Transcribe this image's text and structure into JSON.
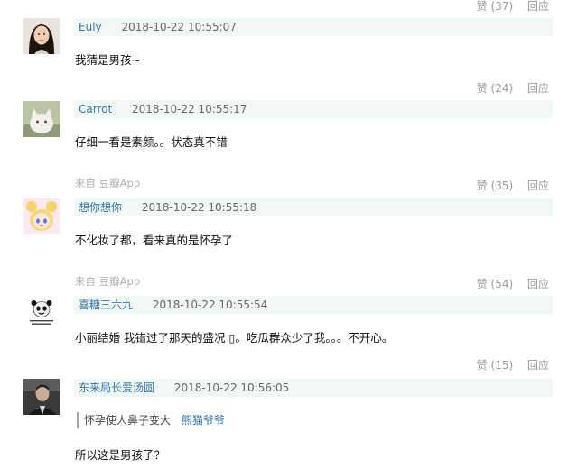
{
  "top_actions": {
    "like": "赞 (37)",
    "reply": "回应"
  },
  "comments": [
    {
      "username": "Euly",
      "time": "2018-10-22 10:55:07",
      "text": "我猜是男孩~",
      "actions": {
        "like": "赞 (24)",
        "reply": "回应"
      }
    },
    {
      "username": "Carrot",
      "time": "2018-10-22 10:55:17",
      "text": "仔细一看是素颜。。状态真不错",
      "source": "来自  豆瓣App",
      "actions": {
        "like": "赞 (35)",
        "reply": "回应"
      }
    },
    {
      "username": "想你想你",
      "time": "2018-10-22 10:55:18",
      "text": "不化妆了都，看来真的是怀孕了",
      "source": "来自  豆瓣App",
      "actions": {
        "like": "赞 (54)",
        "reply": "回应"
      }
    },
    {
      "username": "喜糖三六九",
      "time": "2018-10-22 10:55:54",
      "text": "小丽结婚 我错过了那天的盛况 ▯。吃瓜群众少了我。。。不开心。",
      "actions": {
        "like": "赞 (15)",
        "reply": "回应"
      }
    },
    {
      "username": "东来局长爱汤圆",
      "time": "2018-10-22 10:56:05",
      "quote": {
        "text": "怀孕使人鼻子变大",
        "author": "熊猫爷爷"
      },
      "text": "所以这是男孩子？"
    }
  ]
}
